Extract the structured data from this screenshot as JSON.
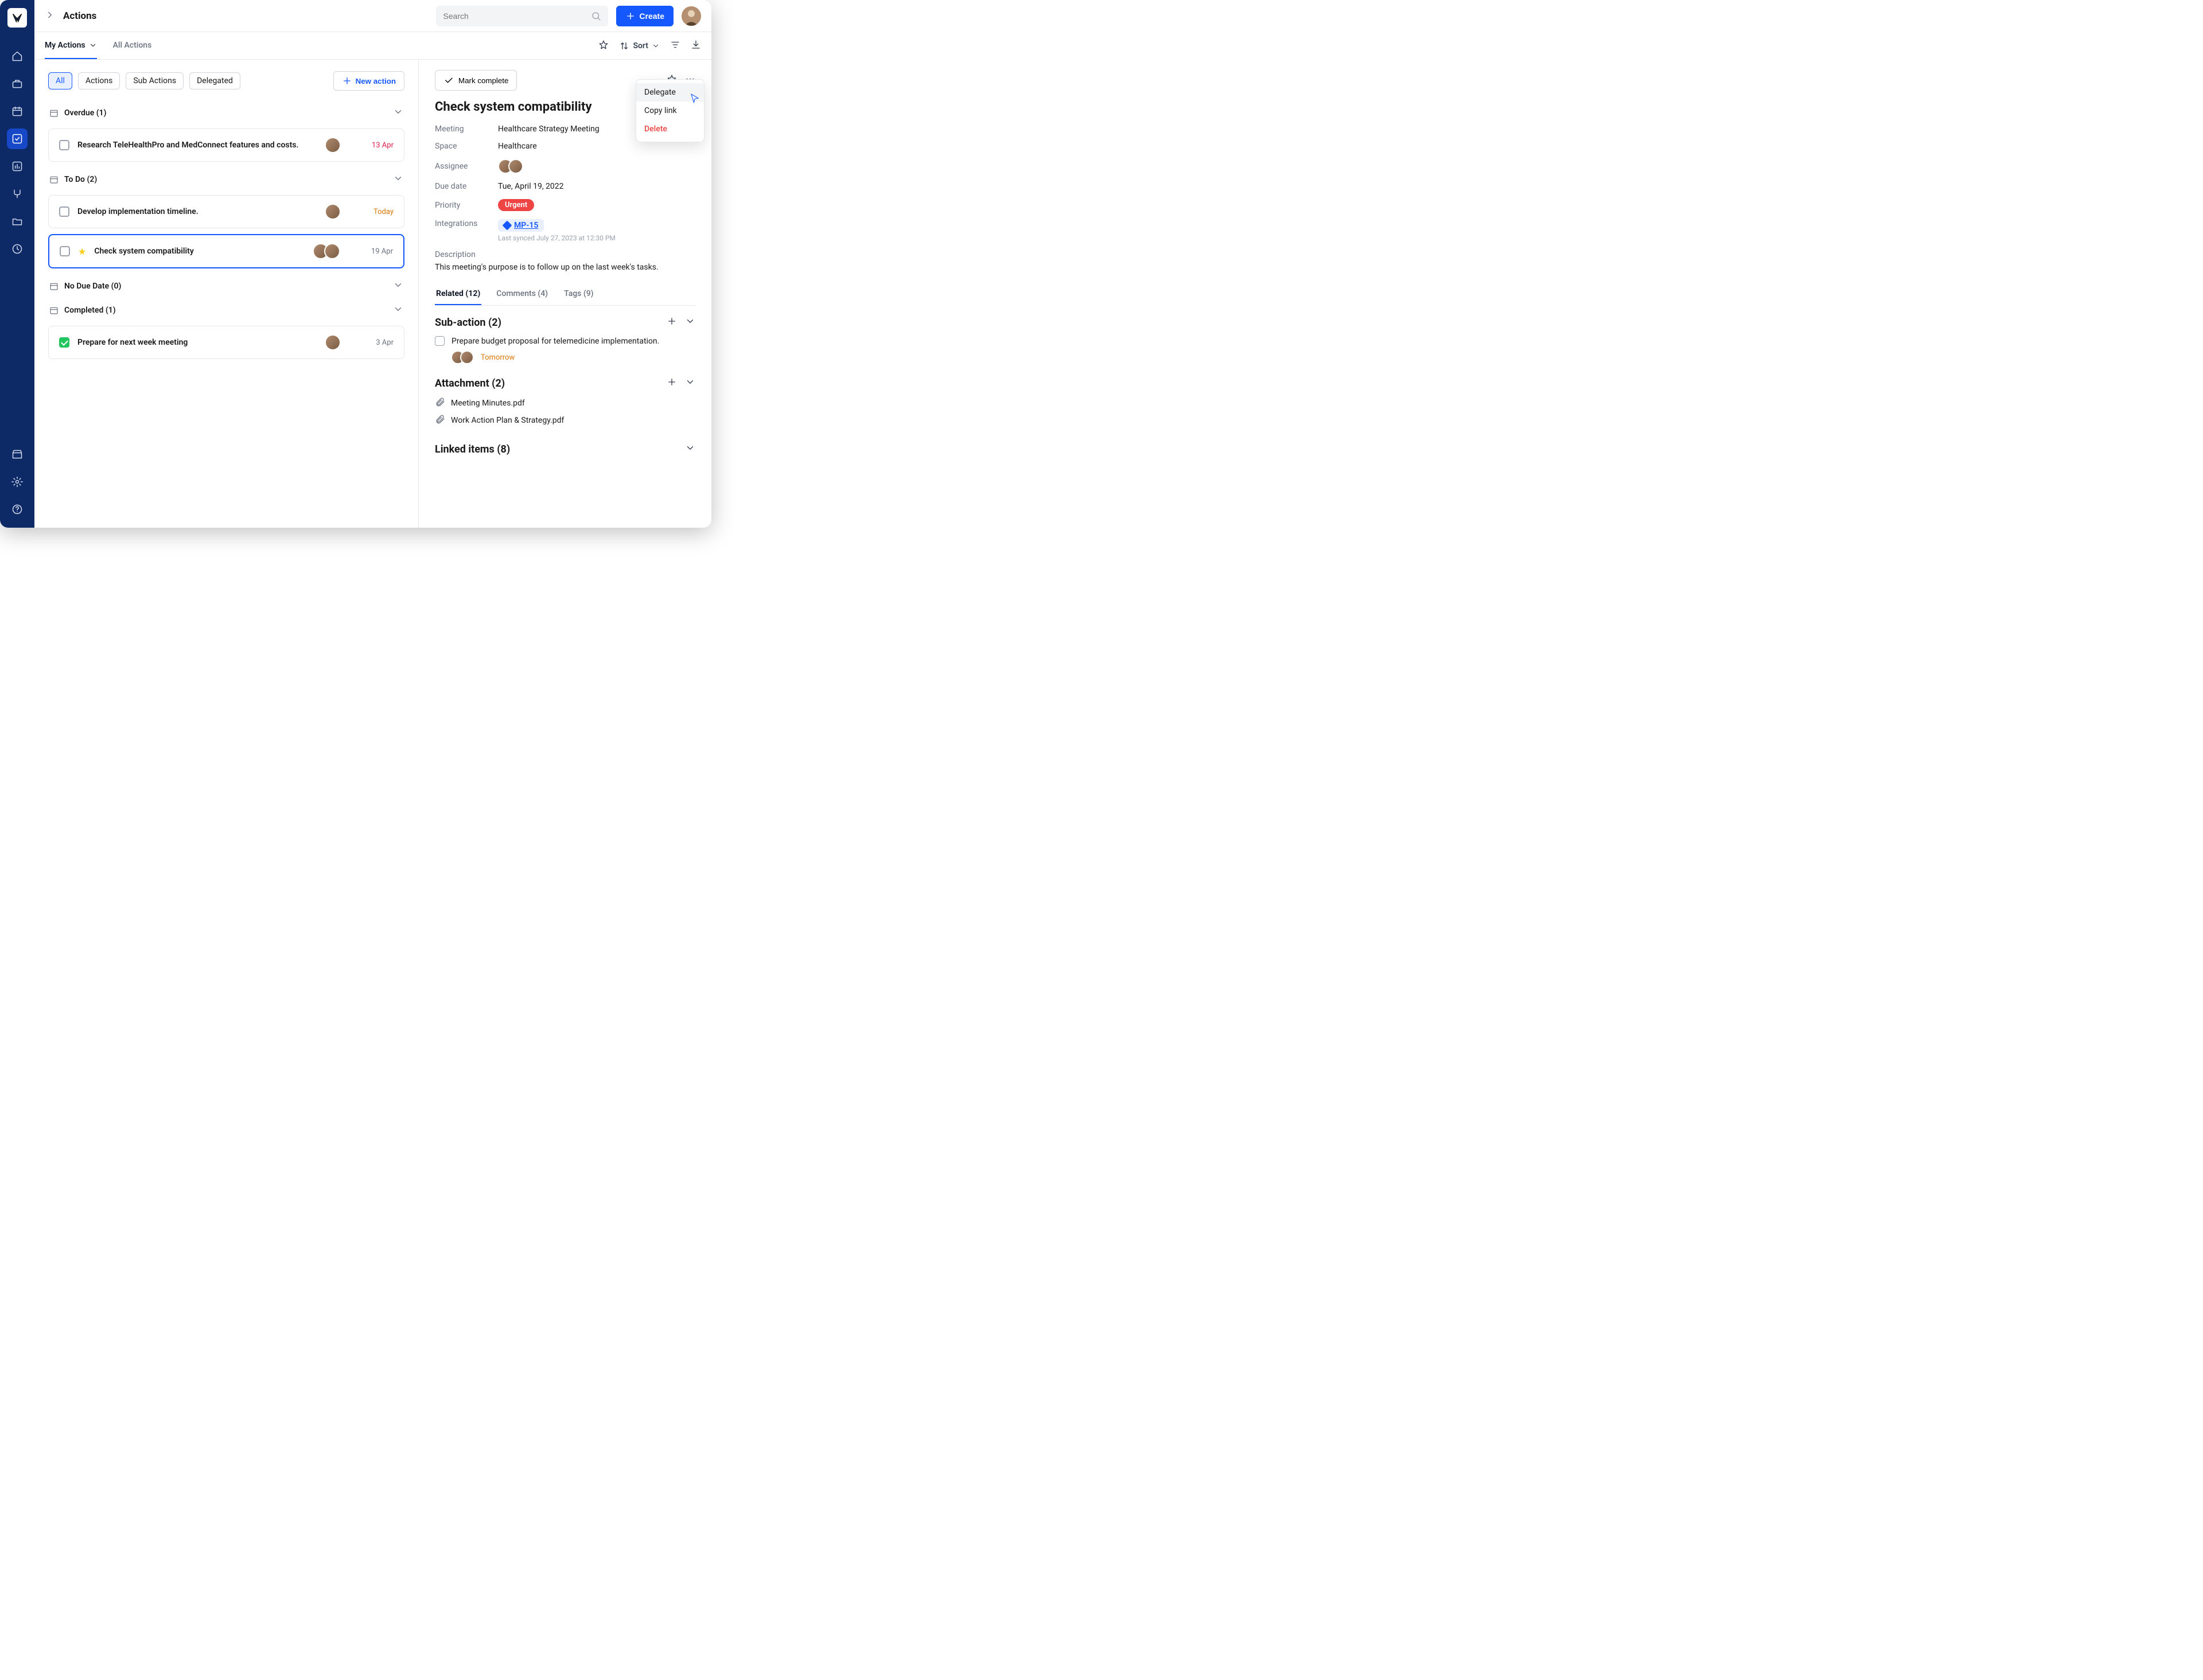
{
  "header": {
    "page_title": "Actions",
    "search_placeholder": "Search",
    "create_label": "Create"
  },
  "subtabs": {
    "my_actions": "My Actions",
    "all_actions": "All Actions",
    "sort_label": "Sort"
  },
  "filters": {
    "all": "All",
    "actions": "Actions",
    "sub_actions": "Sub Actions",
    "delegated": "Delegated",
    "new_action": "New action"
  },
  "sections": {
    "overdue": "Overdue (1)",
    "todo": "To Do (2)",
    "nodue": "No Due Date (0)",
    "completed": "Completed (1)"
  },
  "tasks": {
    "overdue1": {
      "title": "Research TeleHealthPro and MedConnect features and costs.",
      "date": "13 Apr"
    },
    "todo1": {
      "title": "Develop implementation timeline.",
      "date": "Today"
    },
    "todo2": {
      "title": "Check system compatibility",
      "date": "19 Apr"
    },
    "done1": {
      "title": "Prepare for next week meeting",
      "date": "3 Apr"
    }
  },
  "detail": {
    "mark_complete": "Mark complete",
    "title": "Check system compatibility",
    "labels": {
      "meeting": "Meeting",
      "space": "Space",
      "assignee": "Assignee",
      "due_date": "Due date",
      "priority": "Priority",
      "integrations": "Integrations",
      "description": "Description"
    },
    "meeting_value": "Healthcare Strategy Meeting",
    "space_value": "Healthcare",
    "due_value": "Tue, April 19, 2022",
    "priority_value": "Urgent",
    "integration_value": "MP-15",
    "sync_note": "Last synced July 27, 2023 at 12:30 PM",
    "description_body": "This meeting's purpose is to follow up on the last week's tasks.",
    "tabs": {
      "related": "Related (12)",
      "comments": "Comments (4)",
      "tags": "Tags (9)"
    },
    "subactions": {
      "header": "Sub-action (2)",
      "item1": "Prepare budget proposal for telemedicine implementation.",
      "item1_date": "Tomorrow"
    },
    "attachments": {
      "header": "Attachment (2)",
      "file1": "Meeting Minutes.pdf",
      "file2": "Work Action Plan & Strategy.pdf"
    },
    "linked": {
      "header": "Linked items (8)"
    }
  },
  "ctx": {
    "delegate": "Delegate",
    "copy": "Copy link",
    "delete": "Delete"
  }
}
